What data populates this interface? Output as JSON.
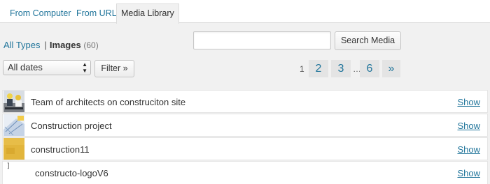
{
  "tabs": [
    {
      "label": "From Computer"
    },
    {
      "label": "From URL"
    },
    {
      "label": "Media Library",
      "active": true
    }
  ],
  "filters": {
    "all_types": "All Types",
    "separator": "|",
    "images_label": "Images",
    "images_count": "(60)"
  },
  "search": {
    "placeholder": "",
    "button_label": "Search Media"
  },
  "date_filter": {
    "selected": "All dates",
    "icon": "updown-arrows-icon"
  },
  "filter_button": {
    "label": "Filter »"
  },
  "pagination": {
    "current": "1",
    "pages": [
      "2",
      "3"
    ],
    "ellipsis": "…",
    "last": "6",
    "next": "»"
  },
  "items": [
    {
      "title": "Team of architects on construciton site",
      "action": "Show",
      "thumb": "architects-photo"
    },
    {
      "title": "Construction project",
      "action": "Show",
      "thumb": "blueprint-photo"
    },
    {
      "title": "construction11",
      "action": "Show",
      "thumb": "yellow-texture"
    },
    {
      "title": "constructo-logoV6",
      "action": "Show",
      "thumb": "broken-image",
      "thumb_text": "]"
    }
  ],
  "colors": {
    "link": "#21759b",
    "background": "#f1f1f1",
    "accent_yellow": "#e2b53c"
  }
}
